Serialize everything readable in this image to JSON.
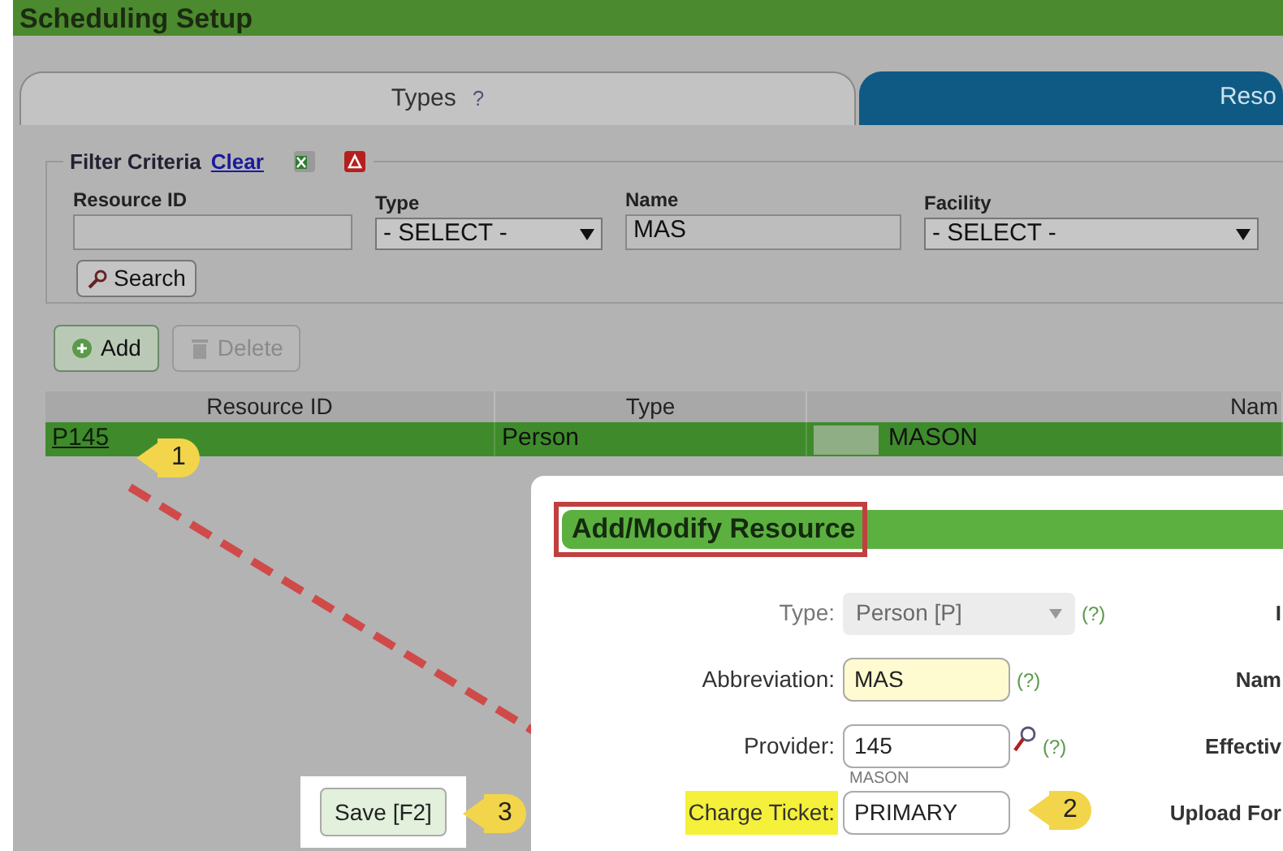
{
  "app_title": "Scheduling Setup",
  "tabs": [
    {
      "label": "Types",
      "help": "?",
      "selected": false
    },
    {
      "label": "Reso",
      "selected": true
    }
  ],
  "filter": {
    "legend": "Filter Criteria",
    "clear_link": "Clear",
    "fields": [
      {
        "label": "Resource ID",
        "kind": "text"
      },
      {
        "label": "Type",
        "kind": "select",
        "value": "- SELECT -"
      },
      {
        "label": "Name",
        "kind": "text",
        "value": "MAS"
      },
      {
        "label": "Facility",
        "kind": "select",
        "value": "- SELECT -"
      }
    ],
    "search_button": "Search"
  },
  "actions": [
    {
      "label": "Add",
      "disabled": false
    },
    {
      "label": "Delete",
      "disabled": true
    }
  ],
  "table": {
    "columns": [
      "Resource ID",
      "Type",
      "Nam"
    ],
    "rows": [
      {
        "cells": [
          "P145",
          "Person",
          "MASON"
        ],
        "selected": true
      }
    ]
  },
  "modal": {
    "title": "Add/Modify Resource",
    "fields": [
      {
        "label": "Type:",
        "kind": "select",
        "value": "Person [P]",
        "disabled": true,
        "highlighted": false,
        "required": false,
        "help": "(?)",
        "lookup": false,
        "right_label": "I"
      },
      {
        "label": "Abbreviation:",
        "kind": "text",
        "value": "MAS",
        "disabled": false,
        "highlighted": false,
        "required": true,
        "help": "(?)",
        "lookup": false,
        "right_label": "Nam"
      },
      {
        "label": "Provider:",
        "kind": "text",
        "value": "145",
        "disabled": false,
        "highlighted": false,
        "required": false,
        "help": "(?)",
        "lookup": true,
        "note": "MASON",
        "right_label": "Effectiv"
      },
      {
        "label": "Charge Ticket:",
        "kind": "text",
        "value": "PRIMARY",
        "disabled": false,
        "highlighted": true,
        "required": false,
        "lookup": false,
        "right_label": "Upload For"
      }
    ]
  },
  "save_button": "Save [F2]",
  "callouts": [
    {
      "number": "1"
    },
    {
      "number": "2"
    },
    {
      "number": "3"
    }
  ]
}
